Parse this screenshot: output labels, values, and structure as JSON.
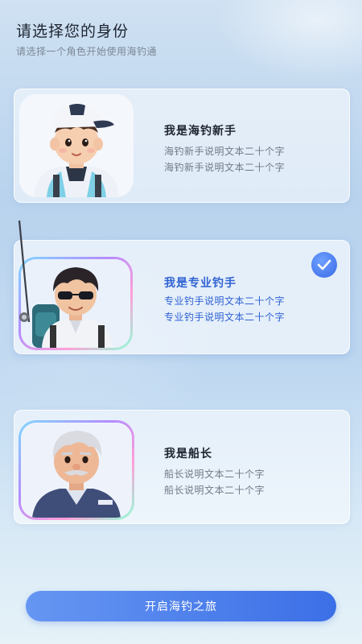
{
  "header": {
    "title": "请选择您的身份",
    "subtitle": "请选择一个角色开始使用海钓通"
  },
  "roles": [
    {
      "name": "我是海钓新手",
      "desc_line1": "海钓新手说明文本二十个字",
      "desc_line2": "海钓新手说明文本二十个字",
      "selected": false,
      "avatar": "beginner-avatar"
    },
    {
      "name": "我是专业钓手",
      "desc_line1": "专业钓手说明文本二十个字",
      "desc_line2": "专业钓手说明文本二十个字",
      "selected": true,
      "avatar": "pro-angler-avatar"
    },
    {
      "name": "我是船长",
      "desc_line1": "船长说明文本二十个字",
      "desc_line2": "船长说明文本二十个字",
      "selected": false,
      "avatar": "captain-avatar"
    }
  ],
  "cta": {
    "label": "开启海钓之旅"
  },
  "colors": {
    "accent": "#3c6fe7",
    "selected_text": "#2f62d4",
    "title_text": "#1d2430",
    "desc_text": "#707a88"
  }
}
